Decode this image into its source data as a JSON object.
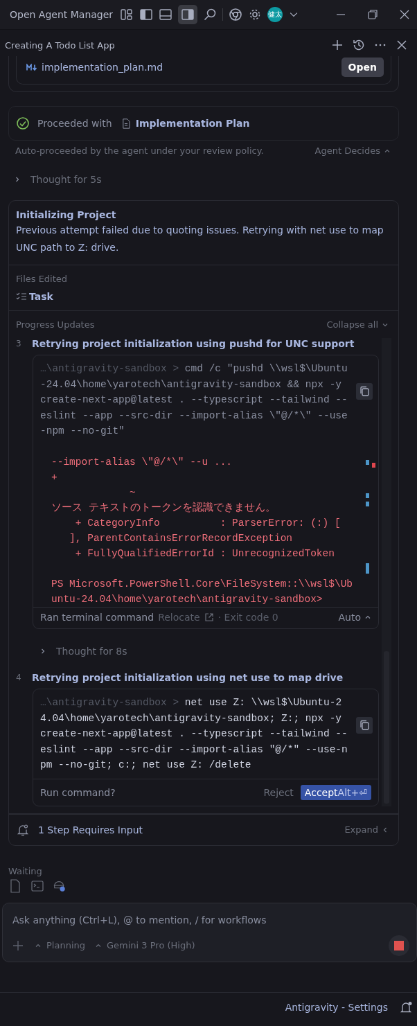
{
  "window": {
    "title": "Open Agent Manager",
    "avatar_text": "健太"
  },
  "conversation": {
    "title": "Creating A Todo List App"
  },
  "artifact": {
    "file_name": "implementation_plan.md",
    "button": "Open"
  },
  "proceeded": {
    "label": "Proceeded with",
    "document": "Implementation Plan"
  },
  "policy_note": {
    "text": "Auto-proceeded by the agent under your review policy.",
    "mode": "Agent Decides"
  },
  "thought_top": {
    "label": "Thought for 5s",
    "expanded": false
  },
  "task": {
    "title": "Initializing Project",
    "description": "Previous attempt failed due to quoting issues. Retrying with net use to map UNC path to Z: drive.",
    "files_heading": "Files Edited",
    "files": [
      "Task"
    ],
    "progress_heading": "Progress Updates",
    "collapse_label": "Collapse all",
    "steps": [
      {
        "number": "3",
        "title": "Retrying project initialization using pushd for UNC support",
        "prompt": "…\\antigravity-sandbox > ",
        "command": "cmd /c \"pushd \\\\wsl$\\Ubuntu-24.04\\home\\yarotech\\antigravity-sandbox && npx -y create-next-app@latest . --typescript --tailwind --eslint --app --src-dir --import-alias \\\"@/*\\\" --use-npm --no-git\"",
        "command_dimmed": true,
        "output": [
          [
            "--import-alias \\\"@/*\\\" --u ...",
            "+",
            "             ~",
            "ソース テキストのトークンを認識できません。",
            "    + CategoryInfo          : ParserError: (:) [",
            "   ], ParentContainsErrorRecordException",
            "    + FullyQualifiedErrorId : UnrecognizedToken"
          ],
          [
            "PS Microsoft.PowerShell.Core\\FileSystem::\\\\wsl$\\Ub",
            "untu-24.04\\home\\yarotech\\antigravity-sandbox>"
          ]
        ],
        "footer": {
          "kind": "ran",
          "status": "Ran terminal command",
          "link": "Relocate",
          "exit": "· Exit code 0",
          "mode": "Auto"
        },
        "thought": {
          "label": "Thought for 8s",
          "expanded": false
        }
      },
      {
        "number": "4",
        "title": "Retrying project initialization using net use to map drive",
        "prompt": "…\\antigravity-sandbox > ",
        "command": "net use Z: \\\\wsl$\\Ubuntu-24.04\\home\\yarotech\\antigravity-sandbox; Z:; npx -y create-next-app@latest . --typescript --tailwind --eslint --app --src-dir --import-alias \"@/*\" --use-npm --no-git; c:; net use Z: /delete",
        "command_dimmed": false,
        "footer": {
          "kind": "pending",
          "question": "Run command?",
          "reject": "Reject",
          "accept": "Accept",
          "shortcut": "Alt+⏎"
        }
      }
    ],
    "pending_note": "1 Step Requires Input",
    "expand_label": "Expand"
  },
  "waiting": {
    "label": "Waiting"
  },
  "composer": {
    "placeholder": "Ask anything (Ctrl+L), @ to mention, / for workflows",
    "mode": "Planning",
    "model": "Gemini 3 Pro (High)"
  },
  "status_bar": {
    "text": "Antigravity - Settings"
  }
}
